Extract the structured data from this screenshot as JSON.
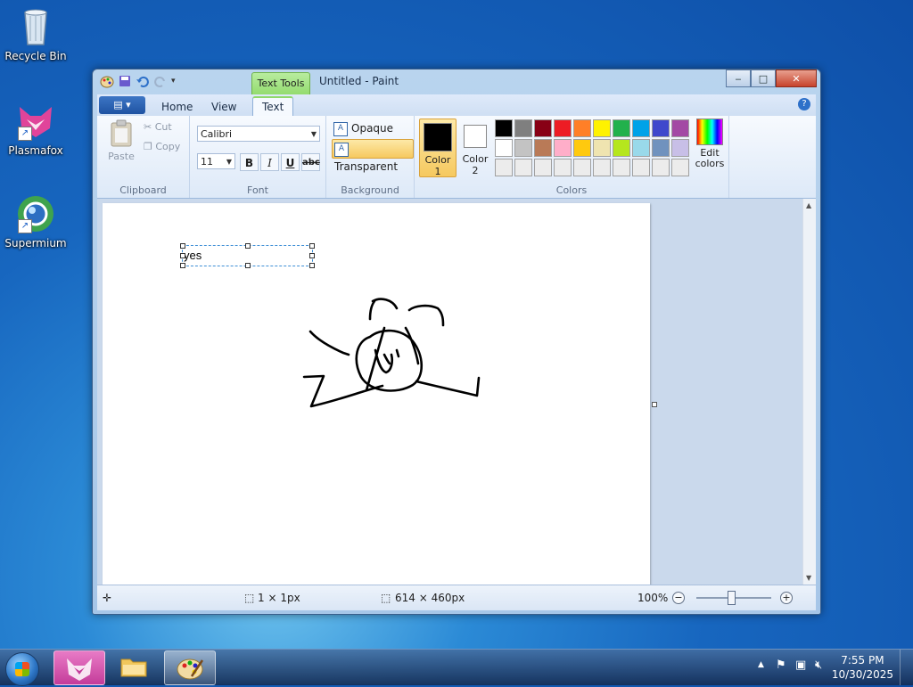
{
  "desktop": {
    "icons": [
      {
        "label": "Recycle Bin",
        "icon": "recycle-bin-icon"
      },
      {
        "label": "Plasmafox",
        "icon": "plasmafox-icon"
      },
      {
        "label": "Supermium",
        "icon": "supermium-icon"
      }
    ]
  },
  "window": {
    "title": "Untitled - Paint",
    "context_tab": "Text Tools",
    "buttons": {
      "minimize": "‒",
      "maximize": "□",
      "close": "✕"
    }
  },
  "ribbon": {
    "tabs": [
      "Home",
      "View",
      "Text"
    ],
    "active_tab": "Text",
    "clipboard": {
      "paste": "Paste",
      "cut": "Cut",
      "copy": "Copy",
      "label": "Clipboard"
    },
    "font": {
      "family": "Calibri",
      "size": "11",
      "bold": "B",
      "italic": "I",
      "underline": "U",
      "strike": "abc",
      "label": "Font"
    },
    "background": {
      "opaque": "Opaque",
      "transparent": "Transparent",
      "selected": "Transparent",
      "label": "Background"
    },
    "colors": {
      "color1_label_line1": "Color",
      "color1_label_line2": "1",
      "color2_label_line1": "Color",
      "color2_label_line2": "2",
      "color1": "#000000",
      "color2": "#ffffff",
      "edit_line1": "Edit",
      "edit_line2": "colors",
      "label": "Colors",
      "palette": [
        "#000000",
        "#7f7f7f",
        "#880015",
        "#ed1c24",
        "#ff7f27",
        "#fff200",
        "#22b14c",
        "#00a2e8",
        "#3f48cc",
        "#a349a4",
        "#ffffff",
        "#c3c3c3",
        "#b97a57",
        "#ffaec9",
        "#ffc90e",
        "#efe4b0",
        "#b5e61d",
        "#99d9ea",
        "#7092be",
        "#c8bfe7",
        "#ececec",
        "#ececec",
        "#ececec",
        "#ececec",
        "#ececec",
        "#ececec",
        "#ececec",
        "#ececec",
        "#ececec",
        "#ececec"
      ]
    }
  },
  "canvas": {
    "text_box_content": "yes"
  },
  "status": {
    "selection_size": "1 × 1px",
    "image_size": "614 × 460px",
    "zoom": "100%"
  },
  "taskbar": {
    "time": "7:55 PM",
    "date": "10/30/2025"
  }
}
